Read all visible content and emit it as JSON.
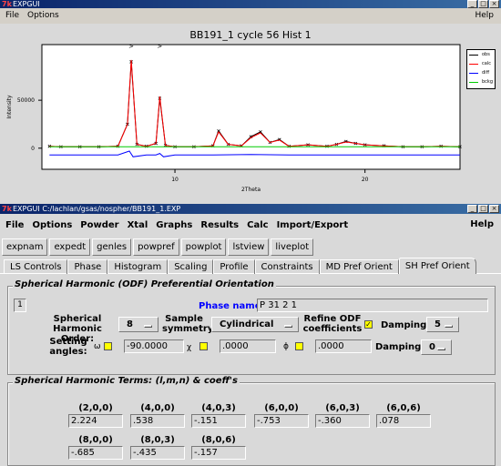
{
  "plot_window": {
    "title": "EXPGUI",
    "menu": {
      "file": "File",
      "options": "Options",
      "help": "Help"
    },
    "plot_title": "BB191_1 cycle 56 Hist 1"
  },
  "chart_data": {
    "type": "line",
    "title": "BB191_1 cycle 56 Hist 1",
    "xlabel": "2Theta",
    "ylabel": "Intensity",
    "xlim": [
      3,
      25
    ],
    "ylim": [
      -22000,
      108000
    ],
    "xticks": [
      "10",
      "20"
    ],
    "yticks": [
      "0",
      "50000"
    ],
    "legend": [
      "obs",
      "calc",
      "diff",
      "bckg"
    ],
    "legend_position": "right",
    "series": [
      {
        "name": "obs",
        "color": "#000000",
        "marker": "x",
        "x": [
          3.4,
          4,
          5,
          6,
          7,
          7.5,
          7.7,
          8,
          8.5,
          9,
          9.2,
          9.5,
          10,
          11,
          12,
          12.3,
          12.8,
          13.5,
          14,
          14.5,
          15,
          15.5,
          16,
          17,
          18,
          18.5,
          19,
          19.5,
          20,
          21,
          22,
          23,
          24,
          25
        ],
        "y": [
          2000,
          1500,
          1500,
          1500,
          2000,
          25000,
          90000,
          4000,
          2000,
          5000,
          52000,
          3000,
          1500,
          1500,
          2500,
          18000,
          4000,
          2500,
          12000,
          17000,
          6000,
          9000,
          2000,
          3500,
          2000,
          4000,
          7000,
          5000,
          3500,
          2500,
          1500,
          1500,
          2000,
          1500
        ]
      },
      {
        "name": "calc",
        "color": "#ff0000",
        "x": [
          3.4,
          4,
          5,
          6,
          7,
          7.5,
          7.7,
          8,
          8.5,
          9,
          9.2,
          9.5,
          10,
          11,
          12,
          12.3,
          12.8,
          13.5,
          14,
          14.5,
          15,
          15.5,
          16,
          17,
          18,
          18.5,
          19,
          19.5,
          20,
          21,
          22,
          23,
          24,
          25
        ],
        "y": [
          2000,
          1500,
          1500,
          1500,
          2000,
          25000,
          92000,
          4000,
          2000,
          5000,
          54000,
          3000,
          1500,
          1500,
          2500,
          17000,
          4000,
          2500,
          11000,
          16000,
          6000,
          8500,
          2000,
          3500,
          2000,
          4000,
          6500,
          5000,
          3500,
          2500,
          1500,
          1500,
          2000,
          1500
        ]
      },
      {
        "name": "diff",
        "color": "#0000ff",
        "x": [
          3.4,
          5,
          7,
          7.6,
          7.8,
          8.5,
          9,
          9.2,
          9.4,
          10,
          12,
          14,
          16,
          18,
          20,
          22,
          25
        ],
        "y": [
          -7000,
          -7000,
          -7000,
          -3000,
          -9000,
          -7000,
          -7000,
          -5500,
          -9000,
          -7000,
          -7000,
          -6500,
          -7000,
          -7000,
          -7000,
          -7000,
          -7000
        ]
      },
      {
        "name": "bckg",
        "color": "#00cc00",
        "x": [
          3.4,
          25
        ],
        "y": [
          1500,
          1500
        ]
      }
    ],
    "peak_markers": [
      7.7,
      9.2
    ],
    "grid": false
  },
  "expgui": {
    "title": "EXPGUI C:/lachlan/gsas/nospher/BB191_1.EXP",
    "menu": [
      "File",
      "Options",
      "Powder",
      "Xtal",
      "Graphs",
      "Results",
      "Calc",
      "Import/Export"
    ],
    "help": "Help",
    "buttons": [
      "expnam",
      "expedt",
      "genles",
      "powpref",
      "powplot",
      "lstview",
      "liveplot"
    ],
    "tabs": [
      "LS Controls",
      "Phase",
      "Histogram",
      "Scaling",
      "Profile",
      "Constraints",
      "MD Pref Orient",
      "SH Pref Orient"
    ],
    "active_tab": "SH Pref Orient",
    "odf": {
      "group_title": "Spherical Harmonic (ODF) Preferential Orientation",
      "phase_number": "1",
      "phase_name_label": "Phase name:",
      "phase_name": "P 31 2 1",
      "sh_order_label": "Spherical Harmonic Order:",
      "sh_order": "8",
      "sample_symmetry_label": "Sample symmetry:",
      "sample_symmetry": "Cylindrical",
      "refine_label": "Refine ODF coefficients",
      "refine_checked": true,
      "damping_label": "Damping",
      "damping1": "5",
      "setting_angles_label": "Setting angles:",
      "omega_symbol": "ω",
      "omega": "-90.0000",
      "chi_symbol": "χ",
      "chi": ".0000",
      "phi_symbol": "ϕ",
      "phi": ".0000",
      "damping2": "0"
    },
    "terms": {
      "group_title": "Spherical Harmonic Terms: (l,m,n) & coeff's",
      "items": [
        {
          "lmn": "(2,0,0)",
          "coeff": "2.224"
        },
        {
          "lmn": "(4,0,0)",
          "coeff": ".538"
        },
        {
          "lmn": "(4,0,3)",
          "coeff": "-.151"
        },
        {
          "lmn": "(6,0,0)",
          "coeff": "-.753"
        },
        {
          "lmn": "(6,0,3)",
          "coeff": "-.360"
        },
        {
          "lmn": "(6,0,6)",
          "coeff": ".078"
        },
        {
          "lmn": "(8,0,0)",
          "coeff": "-.685"
        },
        {
          "lmn": "(8,0,3)",
          "coeff": "-.435"
        },
        {
          "lmn": "(8,0,6)",
          "coeff": "-.157"
        }
      ]
    }
  }
}
